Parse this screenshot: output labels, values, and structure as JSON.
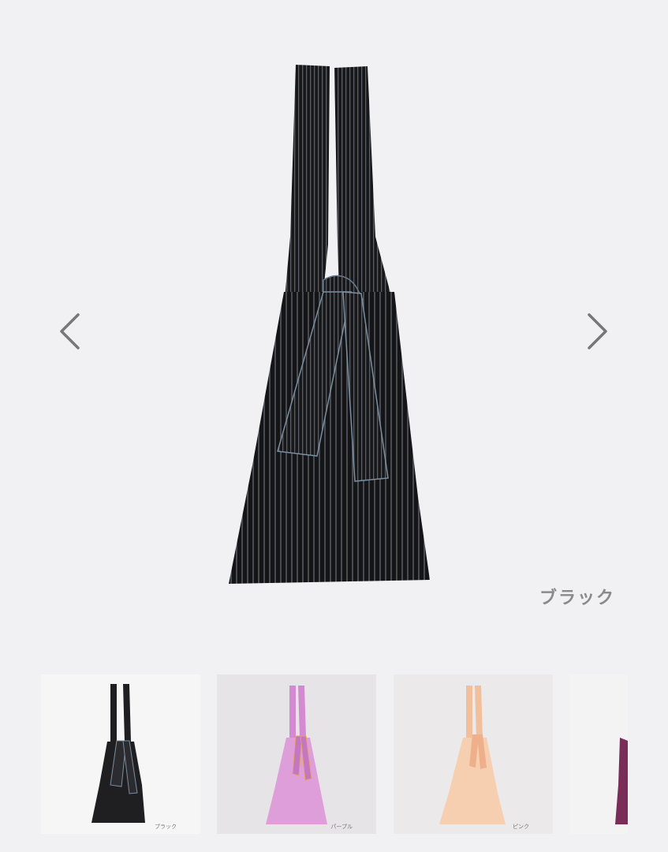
{
  "product": {
    "selected_color_label": "ブラック"
  },
  "navigation": {
    "prev_icon": "chevron-left-icon",
    "next_icon": "chevron-right-icon"
  },
  "thumbnails": [
    {
      "label": "ブラック",
      "color": "#1f1f22"
    },
    {
      "label": "パープル",
      "color": "#d48ad0"
    },
    {
      "label": "ピンク",
      "color": "#f5c7a6"
    },
    {
      "label": "",
      "color": "#7b2d5a"
    }
  ]
}
